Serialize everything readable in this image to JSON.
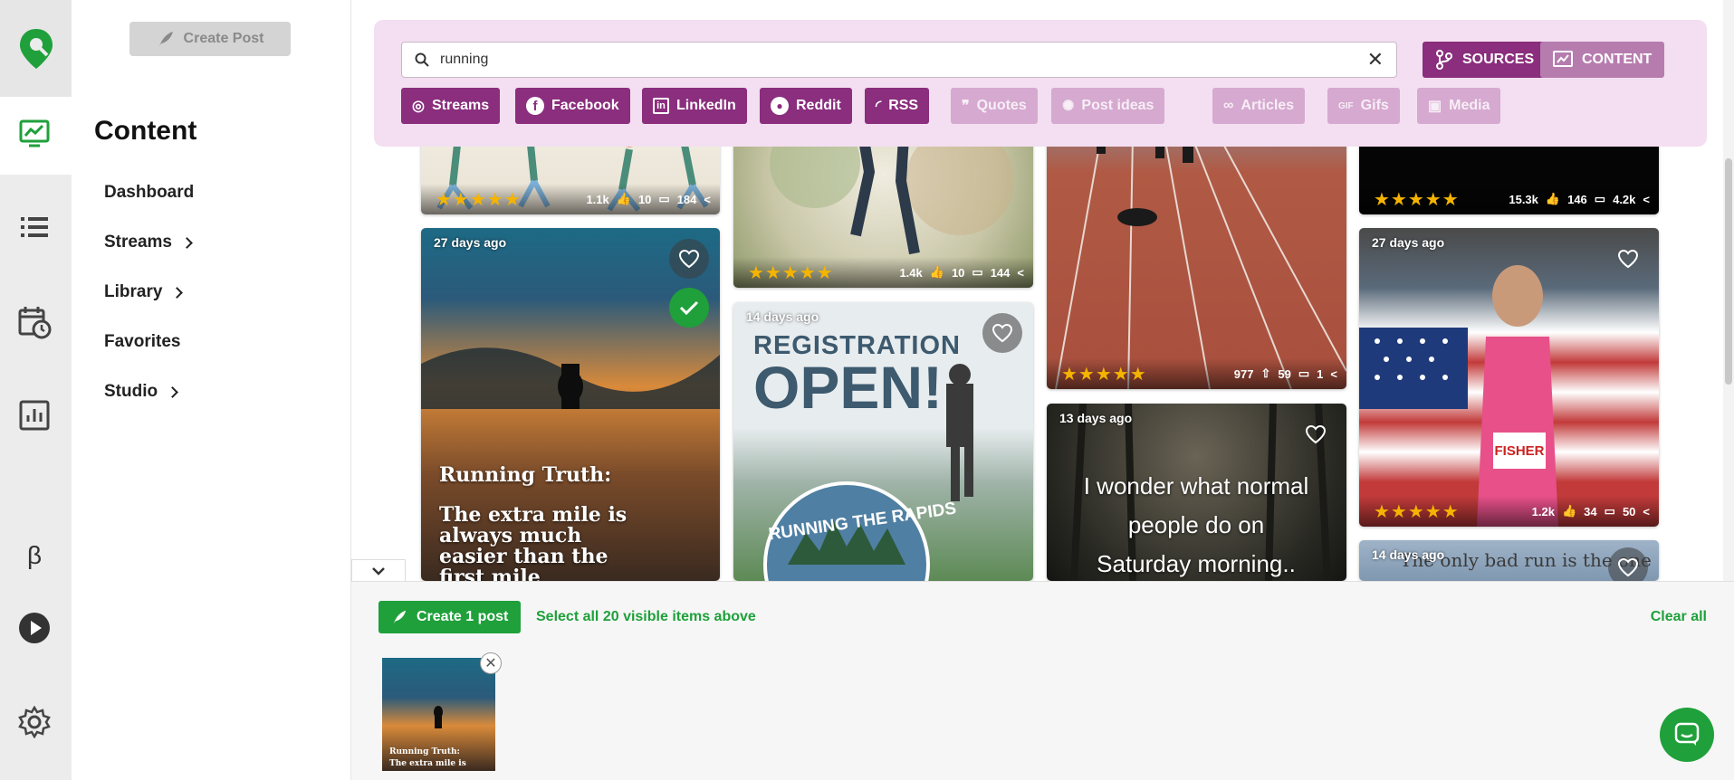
{
  "colors": {
    "brand_green": "#1fa03b",
    "brand_purple": "#8a2e7d",
    "panel_pink": "#f3dff1",
    "star": "#f5b400"
  },
  "rail": {
    "icons": [
      "logo-pin-icon",
      "content-chart-icon",
      "list-icon",
      "calendar-clock-icon",
      "analytics-icon",
      "beta-icon",
      "play-icon",
      "gear-icon"
    ],
    "beta_label": "β"
  },
  "subnav": {
    "create_post_label": "Create Post",
    "title": "Content",
    "items": [
      {
        "label": "Dashboard",
        "has_chevron": false
      },
      {
        "label": "Streams",
        "has_chevron": true
      },
      {
        "label": "Library",
        "has_chevron": true
      },
      {
        "label": "Favorites",
        "has_chevron": false
      },
      {
        "label": "Studio",
        "has_chevron": true
      }
    ]
  },
  "search": {
    "value": "running",
    "sources_label": "SOURCES",
    "content_label": "CONTENT",
    "chips": [
      {
        "label": "Streams",
        "icon": "streams-icon",
        "active": true
      },
      {
        "label": "Facebook",
        "icon": "facebook-icon",
        "active": true
      },
      {
        "label": "LinkedIn",
        "icon": "linkedin-icon",
        "active": true
      },
      {
        "label": "Reddit",
        "icon": "reddit-icon",
        "active": true
      },
      {
        "label": "RSS",
        "icon": "rss-icon",
        "active": true
      },
      {
        "label": "Quotes",
        "icon": "quote-icon",
        "active": false
      },
      {
        "label": "Post ideas",
        "icon": "lightbulb-icon",
        "active": false
      },
      {
        "label": "Articles",
        "icon": "link-icon",
        "active": false
      },
      {
        "label": "Gifs",
        "icon": "gif-icon",
        "active": false
      },
      {
        "label": "Media",
        "icon": "image-icon",
        "active": false
      }
    ]
  },
  "cards": {
    "c1": {
      "stats": [
        "1.1k",
        "10",
        "184"
      ],
      "rating": "★★★★★"
    },
    "c2": {
      "stats": [
        "1.4k",
        "10",
        "144"
      ],
      "rating": "★★★★★"
    },
    "c3": {
      "stats": [
        "977",
        "59",
        "1"
      ],
      "rating": "★★★★★"
    },
    "c4": {
      "stats": [
        "15.3k",
        "146",
        "4.2k"
      ],
      "rating": "★★★★★"
    },
    "c5": {
      "time": "27 days ago",
      "headline": "Running Truth:",
      "quote": "The extra mile is always much easier than the first mile"
    },
    "c6": {
      "time": "14 days ago",
      "headline": "REGISTRATION",
      "headline2": "OPEN!",
      "badge": "RUNNING THE RAPIDS"
    },
    "c7": {
      "time": "13 days ago",
      "quote": "I wonder what normal people do on Saturday morning.."
    },
    "c8": {
      "time": "27 days ago",
      "stats": [
        "1.2k",
        "34",
        "50"
      ],
      "rating": "★★★★★",
      "bib": "FISHER"
    },
    "c9": {
      "time": "14 days ago",
      "quote": "The only bad run is the one"
    }
  },
  "tray": {
    "create_label": "Create 1 post",
    "select_all_label": "Select all 20 visible items above",
    "clear_all_label": "Clear all",
    "thumb_text_1": "Running Truth:",
    "thumb_text_2": "The extra mile is"
  }
}
